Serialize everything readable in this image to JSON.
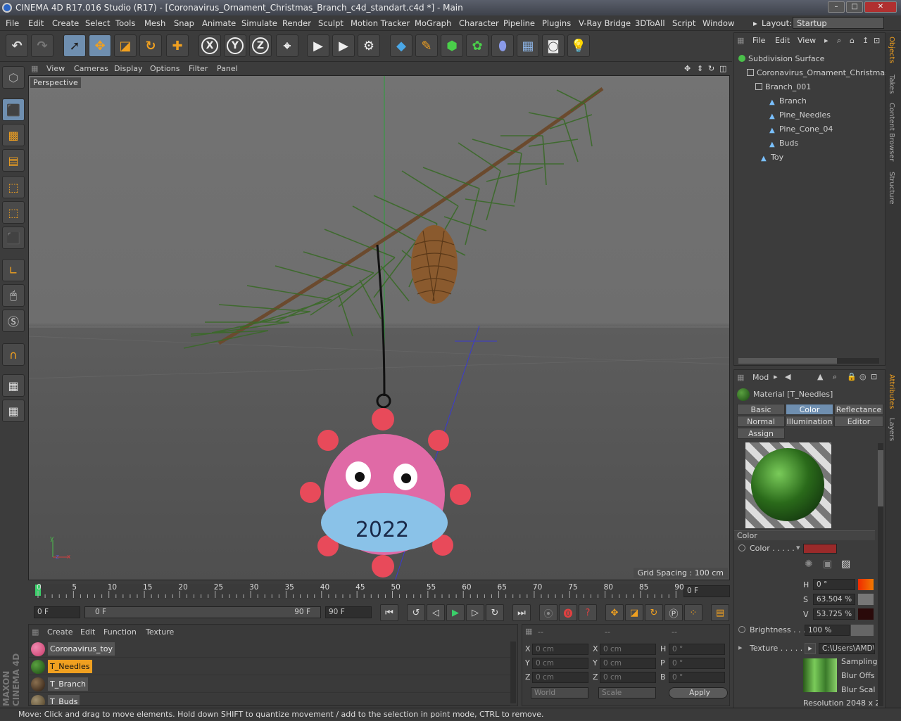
{
  "window": {
    "title": "CINEMA 4D R17.016 Studio (R17) - [Coronavirus_Ornament_Christmas_Branch_c4d_standart.c4d *] - Main"
  },
  "menu": [
    "File",
    "Edit",
    "Create",
    "Select",
    "Tools",
    "Mesh",
    "Snap",
    "Animate",
    "Simulate",
    "Render",
    "Sculpt",
    "Motion Tracker",
    "MoGraph",
    "Character",
    "Pipeline",
    "Plugins",
    "V-Ray Bridge",
    "3DToAll",
    "Script",
    "Window"
  ],
  "layout": {
    "label": "Layout:",
    "value": "Startup"
  },
  "toolbar": {
    "undo": "undo-icon",
    "redo": "redo-icon",
    "x": "X",
    "y": "Y",
    "z": "Z"
  },
  "viewport": {
    "menu": [
      "View",
      "Cameras",
      "Display",
      "Options",
      "Filter",
      "Panel"
    ],
    "camera_label": "Perspective",
    "grid_spacing": "Grid Spacing : 100 cm",
    "ornament_text": "2022"
  },
  "timeline": {
    "ticks": [
      "0",
      "5",
      "10",
      "15",
      "20",
      "25",
      "30",
      "35",
      "40",
      "45",
      "50",
      "55",
      "60",
      "65",
      "70",
      "75",
      "80",
      "85",
      "90"
    ],
    "current_frame": "0 F",
    "start": "0 F",
    "range_start": "0 F",
    "range_end": "90 F",
    "end": "90 F"
  },
  "materials": {
    "menu": [
      "Create",
      "Edit",
      "Function",
      "Texture"
    ],
    "items": [
      {
        "name": "Coronavirus_toy",
        "color": "#c83a6a"
      },
      {
        "name": "T_Needles",
        "color": "#2f6a22",
        "selected": true
      },
      {
        "name": "T_Branch",
        "color": "#4a3a2a"
      },
      {
        "name": "T_Buds",
        "color": "#6a5a40"
      }
    ]
  },
  "coords": {
    "headers": [
      "--",
      "--",
      "--"
    ],
    "rows": [
      {
        "l1": "X",
        "v1": "0 cm",
        "l2": "X",
        "v2": "0 cm",
        "l3": "H",
        "v3": "0 °"
      },
      {
        "l1": "Y",
        "v1": "0 cm",
        "l2": "Y",
        "v2": "0 cm",
        "l3": "P",
        "v3": "0 °"
      },
      {
        "l1": "Z",
        "v1": "0 cm",
        "l2": "Z",
        "v2": "0 cm",
        "l3": "B",
        "v3": "0 °"
      }
    ],
    "mode1": "World",
    "mode2": "Scale",
    "apply": "Apply"
  },
  "objects": {
    "menu": [
      "File",
      "Edit",
      "View"
    ],
    "items": [
      "Subdivision Surface",
      "Coronavirus_Ornament_Christmas",
      "Branch_001",
      "Branch",
      "Pine_Needles",
      "Pine_Cone_04",
      "Buds",
      "Toy"
    ]
  },
  "attributes": {
    "mode": "Mod",
    "material": "Material [T_Needles]",
    "tabs": [
      "Basic",
      "Color",
      "Reflectance",
      "Normal",
      "Illumination",
      "Editor",
      "Assign"
    ],
    "section": "Color",
    "color_label": "Color . . . . .",
    "h_label": "H",
    "h_value": "0 °",
    "s_label": "S",
    "s_value": "63.504 %",
    "v_label": "V",
    "v_value": "53.725 %",
    "brightness_label": "Brightness . . .",
    "brightness_value": "100 %",
    "texture_label": "Texture . . . . . .",
    "texture_path": "C:\\Users\\AMD\\",
    "sampling": "Sampling",
    "blur_offset": "Blur Offs",
    "blur_scale": "Blur Scal",
    "resolution": "Resolution 2048 x 2"
  },
  "sidetabs": [
    "Objects",
    "Takes",
    "Content Browser",
    "Structure",
    "Attributes",
    "Layers"
  ],
  "status": "Move: Click and drag to move elements. Hold down SHIFT to quantize movement / add to the selection in point mode, CTRL to remove.",
  "brand": "MAXON CINEMA 4D"
}
